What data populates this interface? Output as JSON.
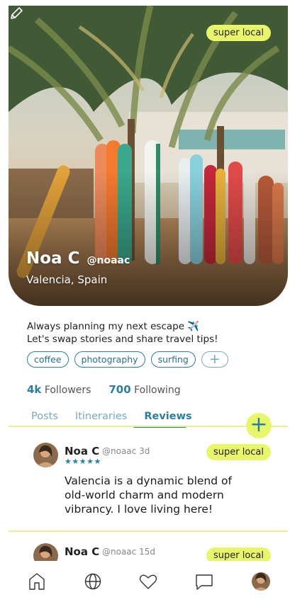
{
  "profile": {
    "badge": "super local",
    "name": "Noa C",
    "handle": "@noaac",
    "location": "Valencia, Spain",
    "bio_line1": "Always planning my next escape ✈️",
    "bio_line2": "Let's swap stories and share travel tips!",
    "tags": [
      "coffee",
      "photography",
      "surfing"
    ],
    "add_tag": "+",
    "followers_count": "4k",
    "followers_label": "Followers",
    "following_count": "700",
    "following_label": "Following"
  },
  "tabs": {
    "posts": "Posts",
    "itineraries": "Itineraries",
    "reviews": "Reviews",
    "active": "Reviews"
  },
  "fab_label": "+",
  "reviews": [
    {
      "name": "Noa C",
      "handle": "@noaac",
      "age": "3d",
      "stars": "★★★★★",
      "rating": 5,
      "badge": "super local",
      "text": "Valencia is a dynamic blend of old-world charm and modern vibrancy. I love living here!"
    },
    {
      "name": "Noa C",
      "handle": "@noaac",
      "age": "15d",
      "badge": "super local"
    }
  ],
  "nav": [
    "home-icon",
    "globe-icon",
    "heart-icon",
    "chat-icon",
    "profile-avatar"
  ],
  "colors": {
    "accent": "#2a7fa0",
    "badge": "#e8f76a",
    "divider": "#e6f28a"
  }
}
